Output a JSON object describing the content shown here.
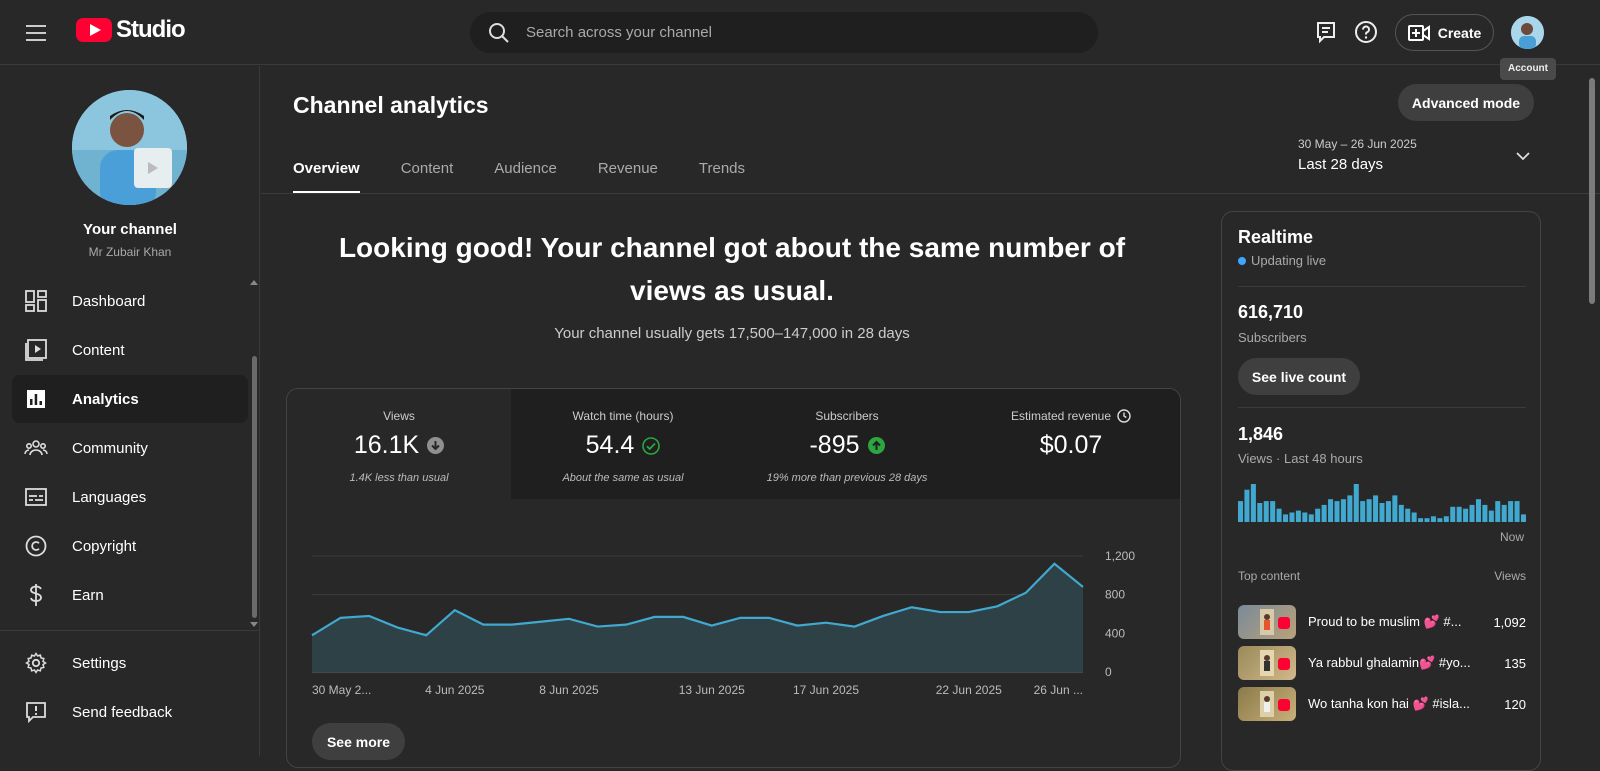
{
  "header": {
    "logo_text": "Studio",
    "search_placeholder": "Search across your channel",
    "create_label": "Create",
    "account_tooltip": "Account"
  },
  "sidebar": {
    "your_channel": "Your channel",
    "channel_name": "Mr Zubair Khan",
    "items": [
      {
        "label": "Dashboard",
        "icon": "dashboard-icon"
      },
      {
        "label": "Content",
        "icon": "content-icon"
      },
      {
        "label": "Analytics",
        "icon": "analytics-icon",
        "active": true
      },
      {
        "label": "Community",
        "icon": "community-icon"
      },
      {
        "label": "Languages",
        "icon": "languages-icon"
      },
      {
        "label": "Copyright",
        "icon": "copyright-icon"
      },
      {
        "label": "Earn",
        "icon": "earn-icon"
      }
    ],
    "bottom_items": [
      {
        "label": "Settings",
        "icon": "settings-icon"
      },
      {
        "label": "Send feedback",
        "icon": "feedback-icon"
      }
    ]
  },
  "main": {
    "title": "Channel analytics",
    "advanced_mode": "Advanced mode",
    "tabs": [
      "Overview",
      "Content",
      "Audience",
      "Revenue",
      "Trends"
    ],
    "date_range": {
      "dates": "30 May – 26 Jun 2025",
      "label": "Last 28 days"
    },
    "headline": "Looking good! Your channel got about the same number of views as usual.",
    "subline": "Your channel usually gets 17,500–147,000 in 28 days",
    "see_more": "See more",
    "metrics": [
      {
        "label": "Views",
        "value": "16.1K",
        "note": "1.4K less than usual",
        "status": "down"
      },
      {
        "label": "Watch time (hours)",
        "value": "54.4",
        "note": "About the same as usual",
        "status": "same"
      },
      {
        "label": "Subscribers",
        "value": "-895",
        "note": "19% more than previous 28 days",
        "status": "up"
      },
      {
        "label": "Estimated revenue",
        "value": "$0.07",
        "note": "",
        "status": "info"
      }
    ]
  },
  "chart_data": {
    "type": "area",
    "series": [
      {
        "values": [
          380,
          560,
          580,
          460,
          380,
          640,
          490,
          490,
          520,
          550,
          470,
          490,
          570,
          570,
          480,
          560,
          560,
          480,
          510,
          470,
          580,
          670,
          620,
          620,
          680,
          820,
          1120,
          880
        ]
      }
    ],
    "x_tick_labels": [
      "30 May 2...",
      "4 Jun 2025",
      "8 Jun 2025",
      "13 Jun 2025",
      "17 Jun 2025",
      "22 Jun 2025",
      "26 Jun ..."
    ],
    "x_tick_indices": [
      0,
      5,
      9,
      14,
      18,
      23,
      27
    ],
    "y_ticks": [
      "0",
      "400",
      "800",
      "1,200"
    ],
    "ylim": [
      0,
      1200
    ],
    "grid": true,
    "colors": {
      "line": "#41a9cf",
      "fill": "#2e4146"
    }
  },
  "realtime": {
    "title": "Realtime",
    "status": "Updating live",
    "subscribers_value": "616,710",
    "subscribers_label": "Subscribers",
    "live_count_label": "See live count",
    "views_value": "1,846",
    "views_label": "Views · Last 48 hours",
    "now_label": "Now",
    "bars": [
      0.55,
      0.85,
      1.0,
      0.5,
      0.55,
      0.55,
      0.35,
      0.2,
      0.25,
      0.3,
      0.25,
      0.2,
      0.35,
      0.45,
      0.6,
      0.55,
      0.6,
      0.7,
      1.0,
      0.55,
      0.6,
      0.7,
      0.5,
      0.55,
      0.7,
      0.45,
      0.35,
      0.25,
      0.1,
      0.1,
      0.15,
      0.1,
      0.15,
      0.4,
      0.4,
      0.35,
      0.45,
      0.6,
      0.45,
      0.3,
      0.55,
      0.45,
      0.55,
      0.55,
      0.2
    ],
    "top_content_label": "Top content",
    "views_col_label": "Views",
    "top_content": [
      {
        "title": "Proud to be muslim 💕 #...",
        "views": "1,092"
      },
      {
        "title": "Ya rabbul ghalamin💕 #yo...",
        "views": "135"
      },
      {
        "title": "Wo tanha kon hai 💕 #isla...",
        "views": "120"
      }
    ]
  },
  "colors": {
    "accent_blue": "#3ea6ff",
    "youtube_red": "#ff0033",
    "green": "#2ba640",
    "bg": "#282828"
  }
}
